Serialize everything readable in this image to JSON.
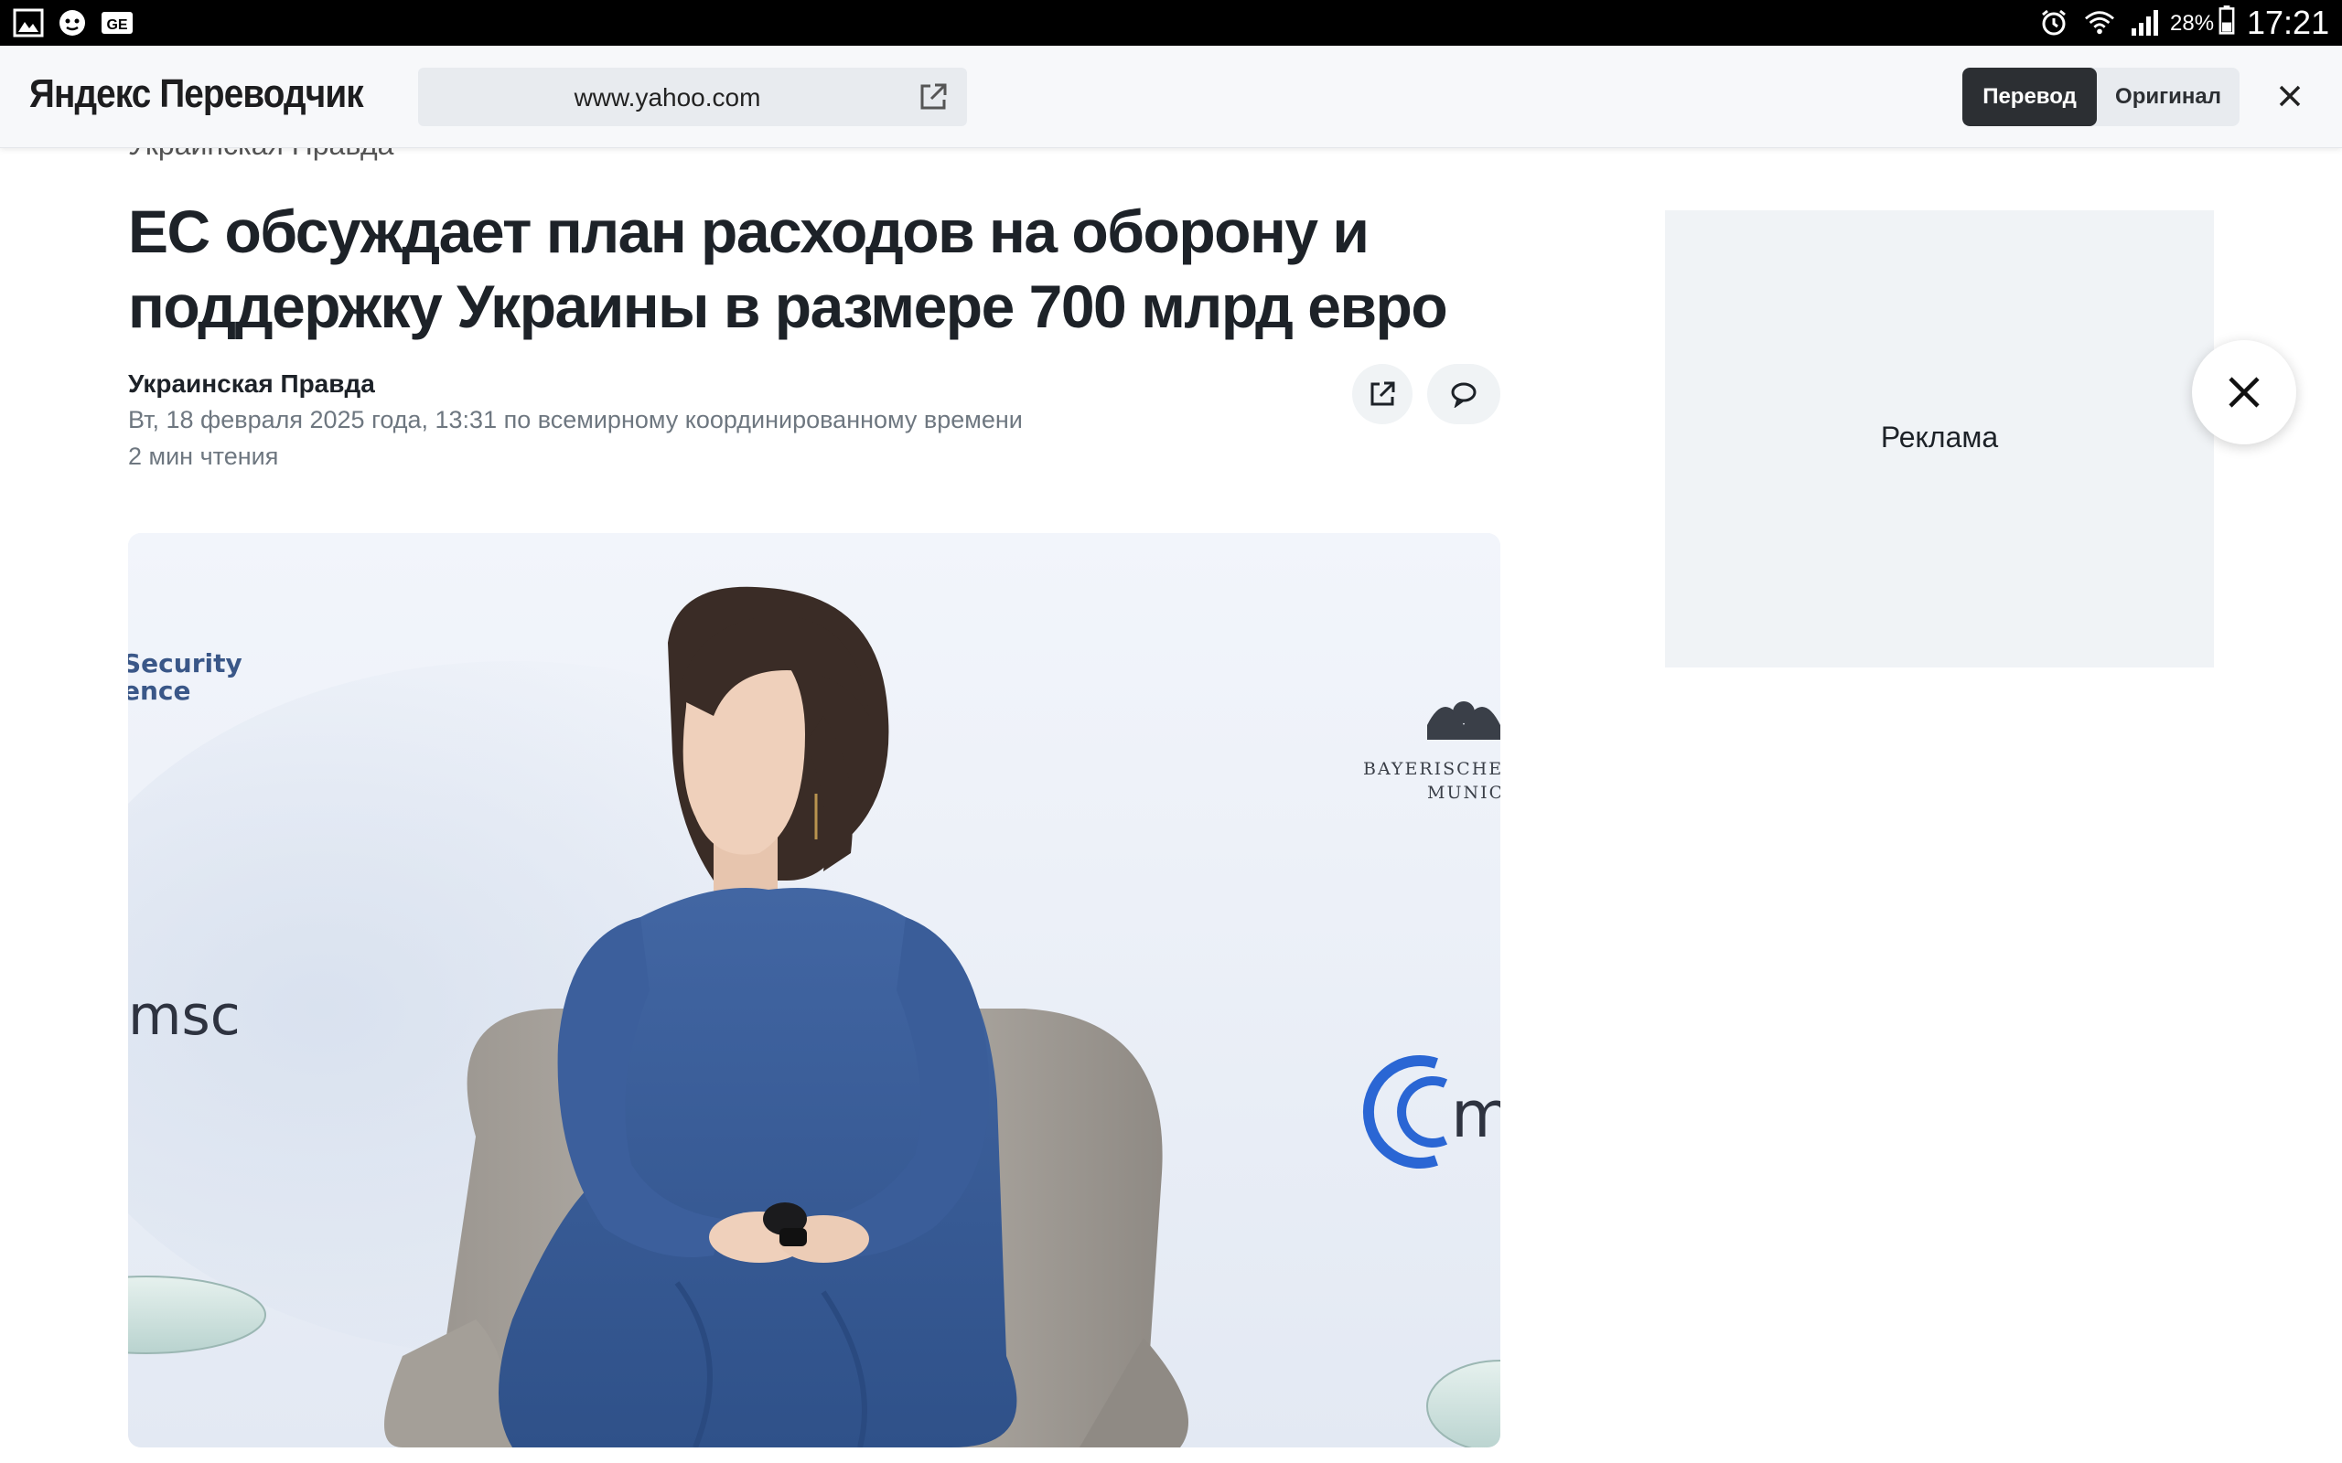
{
  "status_bar": {
    "battery_percent": "28%",
    "time": "17:21",
    "left_icons": [
      "gallery-icon",
      "lion-app-icon",
      "ge-app-icon"
    ],
    "right_icons": [
      "alarm-icon",
      "wifi-icon",
      "signal-icon",
      "battery-icon"
    ]
  },
  "translator_bar": {
    "brand": "Яндекс Переводчик",
    "url": "www.yahoo.com",
    "translate_label": "Перевод",
    "original_label": "Оригинал",
    "active_mode": "Перевод"
  },
  "article": {
    "source_top": "Украинская Правда",
    "headline": "ЕС обсуждает план расходов на оборону и поддержку Украины в размере 700 млрд евро",
    "source": "Украинская Правда",
    "date": "Вт, 18 февраля 2025 года, 13:31 по всемирному координированному времени",
    "read_time": "2 мин чтения",
    "image_text": {
      "security_line1": "Security",
      "security_line2": "ence",
      "msc_left": "msc",
      "bayer_line1": "BAYERISCHE",
      "bayer_line2": "MUNIC",
      "msc_right": "m"
    }
  },
  "sidebar": {
    "ad_label": "Реклама"
  },
  "colors": {
    "status_bar_bg": "#000000",
    "translator_bar_bg": "#f7f8fa",
    "toggle_active_bg": "#2c2f33",
    "headline": "#1d2228",
    "meta_text": "#6e7780",
    "ad_bg": "#f0f3f6",
    "dress_blue": "#3b5f9c",
    "msc_blue": "#2a66d4"
  }
}
